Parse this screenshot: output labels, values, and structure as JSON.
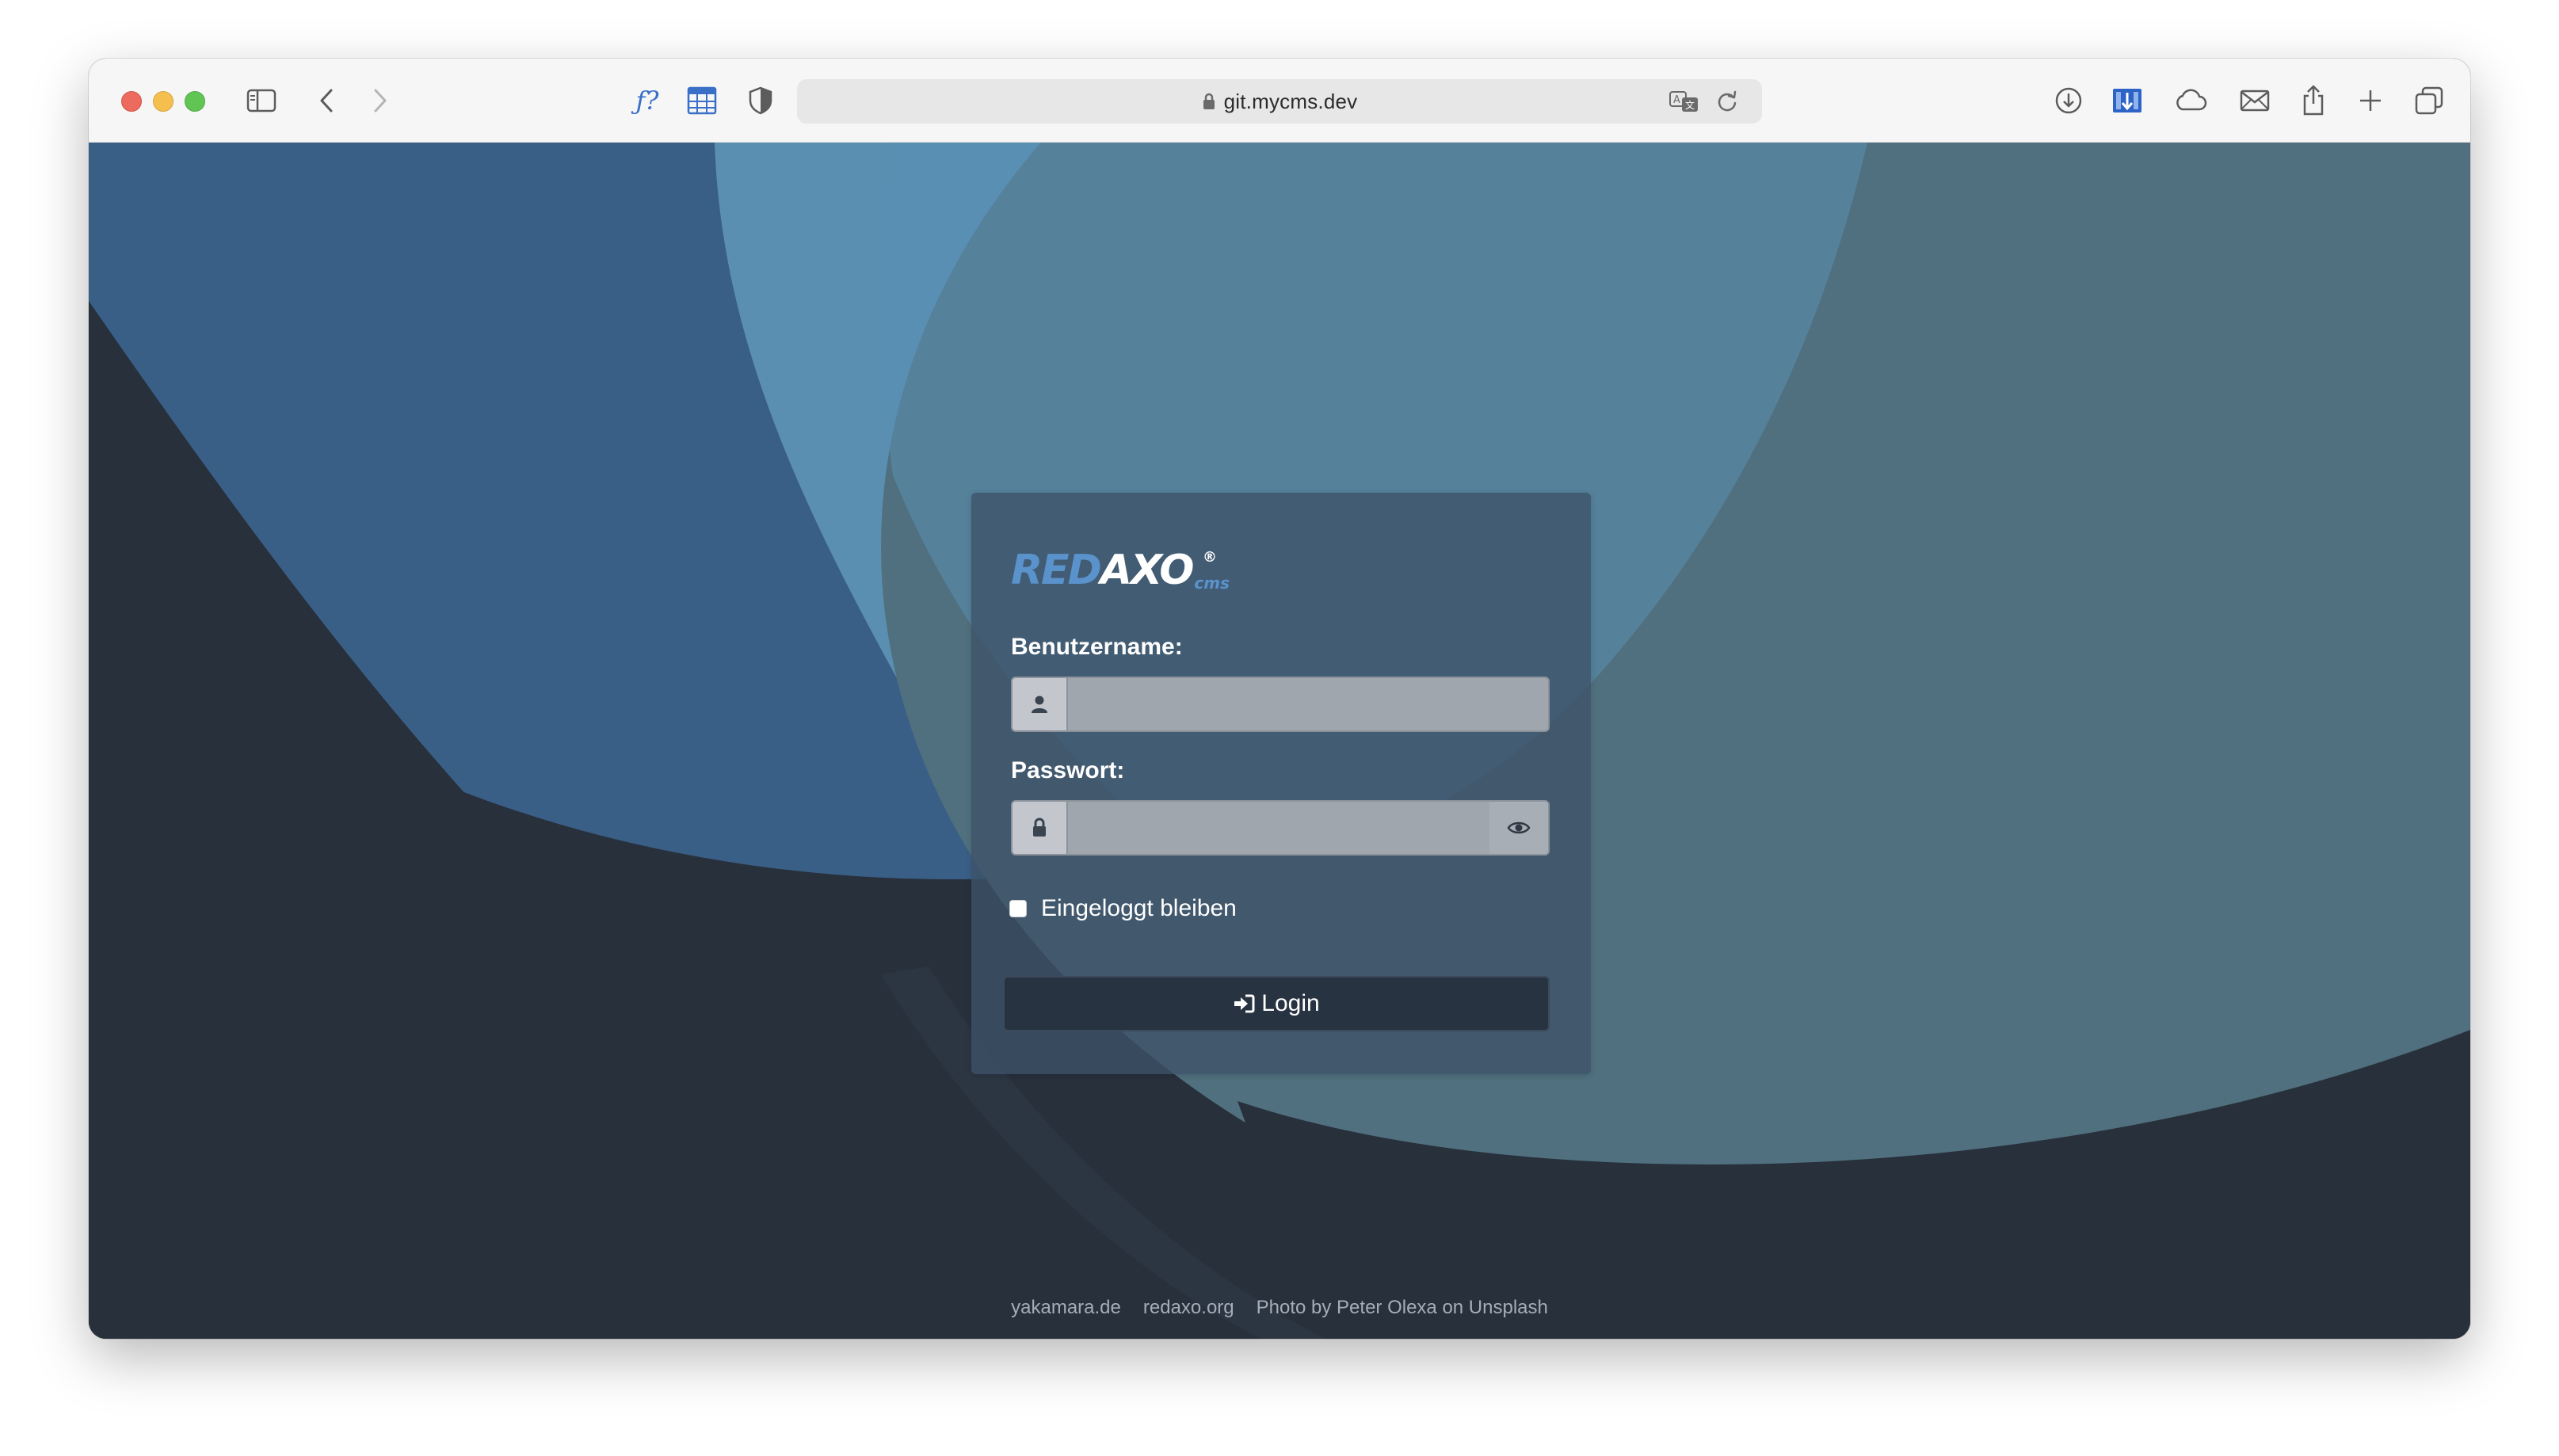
{
  "browser": {
    "url": "git.mycms.dev",
    "toolbar_icons": [
      "sidebar-icon",
      "back-icon",
      "forward-icon",
      "function-icon",
      "table-icon",
      "shield-icon",
      "translate-icon",
      "reload-icon",
      "download-icon",
      "extension-icon",
      "cloud-icon",
      "mail-icon",
      "share-icon",
      "new-tab-icon",
      "tab-overview-icon"
    ]
  },
  "login": {
    "logo_red": "RED",
    "logo_axo": "AXO",
    "logo_cms": "cms",
    "logo_reg": "®",
    "username_label": "Benutzername:",
    "username_value": "",
    "password_label": "Passwort:",
    "password_value": "",
    "remember_label": "Eingeloggt bleiben",
    "remember_checked": false,
    "login_button": "Login"
  },
  "footer": {
    "links": [
      "yakamara.de",
      "redaxo.org",
      "Photo by Peter Olexa on Unsplash"
    ]
  },
  "colors": {
    "page_bg": "#28303c",
    "shape_dark_blue": "#3a5f87",
    "shape_light_blue": "#5a8fb2",
    "shape_slate": "#50707f",
    "logo_blue": "#5a92cc"
  }
}
